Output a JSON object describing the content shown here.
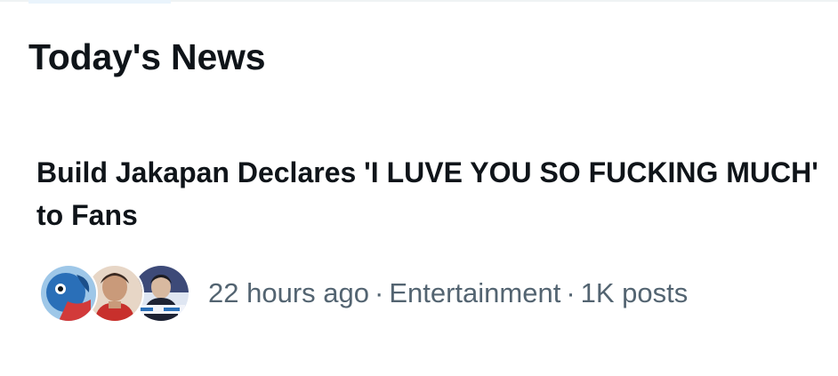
{
  "section": {
    "title": "Today's News"
  },
  "trend": {
    "headline": "Build Jakapan Declares 'I LUVE YOU SO FUCKING MUCH' to Fans",
    "time": "22 hours ago",
    "category": "Entertainment",
    "posts": "1K posts",
    "separator": "·",
    "avatars": [
      {
        "icon": "blue-character-avatar"
      },
      {
        "icon": "person-red-shirt-avatar"
      },
      {
        "icon": "person-stage-avatar"
      }
    ]
  },
  "colors": {
    "text_primary": "#0f1419",
    "text_secondary": "#536471",
    "background": "#ffffff"
  }
}
